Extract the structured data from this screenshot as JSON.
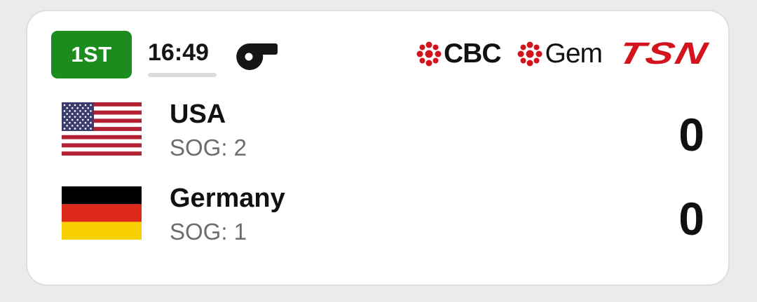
{
  "game": {
    "period": "1ST",
    "clock": "16:49",
    "status_icon": "whistle-icon"
  },
  "broadcasters": [
    {
      "name": "CBC",
      "icon": "cbc-gem-logo-icon",
      "color": "#d4141c"
    },
    {
      "name": "Gem",
      "icon": "cbc-gem-logo-icon",
      "color": "#d4141c"
    },
    {
      "name": "TSN",
      "color": "#d4141c"
    }
  ],
  "teams": [
    {
      "name": "USA",
      "sog": "SOG: 2",
      "score": "0",
      "flag": "usa-flag-icon"
    },
    {
      "name": "Germany",
      "sog": "SOG: 1",
      "score": "0",
      "flag": "germany-flag-icon"
    }
  ],
  "colors": {
    "period_badge": "#1c8c1e",
    "accent_red": "#d4141c"
  }
}
